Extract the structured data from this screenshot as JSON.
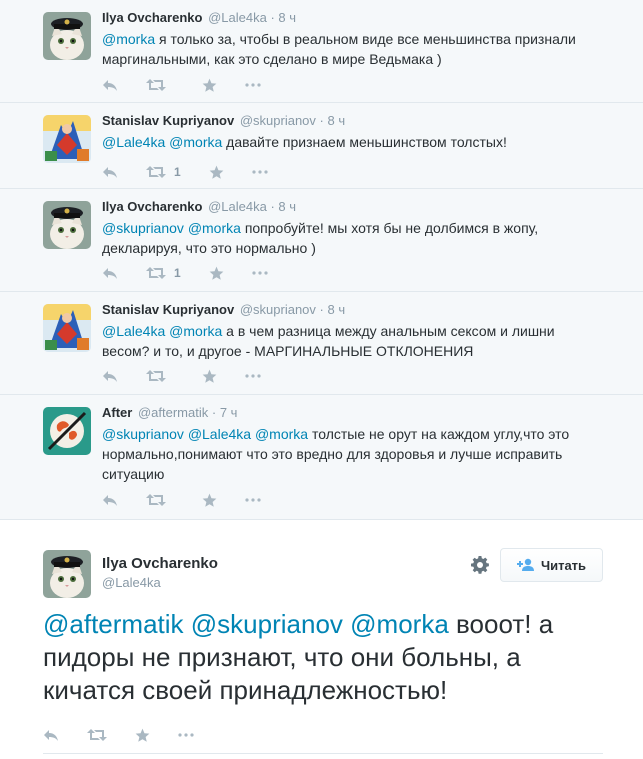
{
  "tweets": [
    {
      "fullname": "Ilya Ovcharenko",
      "username": "@Lale4ka",
      "time": "8 ч",
      "avatar": "cat-captain",
      "mentions": [
        "@morka"
      ],
      "text": "я только за, чтобы в реальном виде все меньшинства признали маргинальными, как это сделано в мире Ведьмака )",
      "retweet_count": ""
    },
    {
      "fullname": "Stanislav Kupriyanov",
      "username": "@skuprianov",
      "time": "8 ч",
      "avatar": "superhero-comic",
      "mentions": [
        "@Lale4ka",
        "@morka"
      ],
      "text": "давайте признаем меньшинством толстых!",
      "retweet_count": "1"
    },
    {
      "fullname": "Ilya Ovcharenko",
      "username": "@Lale4ka",
      "time": "8 ч",
      "avatar": "cat-captain",
      "mentions": [
        "@skuprianov",
        "@morka"
      ],
      "text": "попробуйте! мы хотя бы не долбимся в жопу, декларируя, что это нормально )",
      "retweet_count": "1"
    },
    {
      "fullname": "Stanislav Kupriyanov",
      "username": "@skuprianov",
      "time": "8 ч",
      "avatar": "superhero-comic",
      "mentions": [
        "@Lale4ka",
        "@morka"
      ],
      "text": "а в чем разница между анальным сексом и лишни весом? и то, и другое - МАРГИНАЛЬНЫЕ ОТКЛОНЕНИЯ",
      "retweet_count": ""
    },
    {
      "fullname": "After",
      "username": "@aftermatik",
      "time": "7 ч",
      "avatar": "globe-logo",
      "mentions": [
        "@skuprianov",
        "@Lale4ka",
        "@morka"
      ],
      "text": "толстые не орут на каждом углу,что это нормально,понимают что это вредно для здоровья и лучше исправить ситуацию",
      "retweet_count": ""
    }
  ],
  "main_tweet": {
    "fullname": "Ilya Ovcharenko",
    "username": "@Lale4ka",
    "avatar": "cat-captain",
    "follow_label": "Читать",
    "mentions": [
      "@aftermatik",
      "@skuprianov",
      "@morka"
    ],
    "text": "вооот! а пидоры не признают, что они больны, а кичатся своей принадлежностью!"
  },
  "colors": {
    "link": "#0084b4",
    "muted": "#8899a6",
    "icon": "#aab8c2",
    "text": "#292f33"
  }
}
